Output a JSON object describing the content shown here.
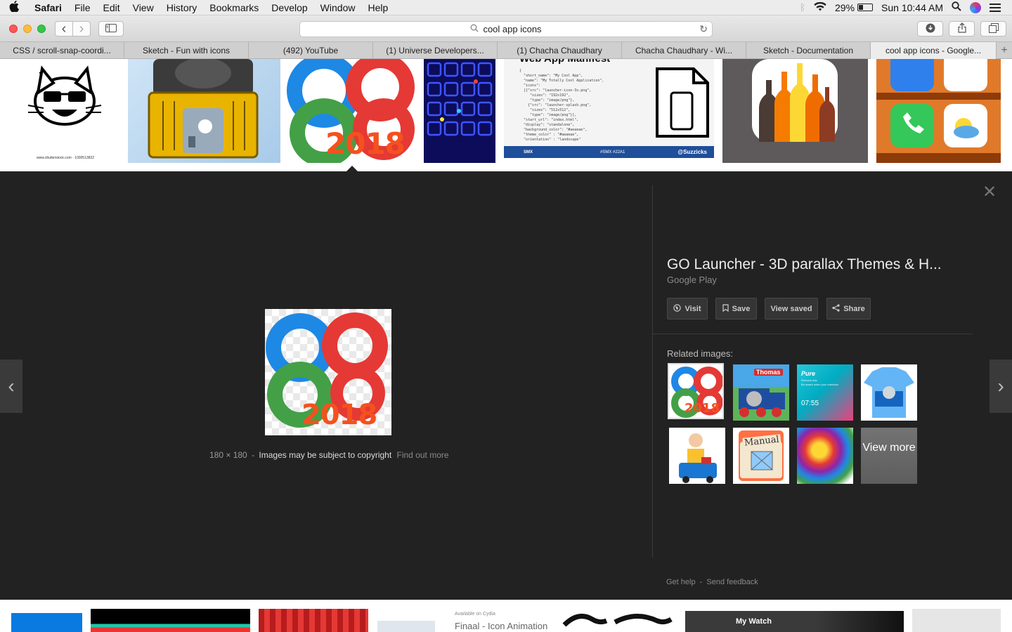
{
  "menubar": {
    "apple": "",
    "items": [
      "Safari",
      "File",
      "Edit",
      "View",
      "History",
      "Bookmarks",
      "Develop",
      "Window",
      "Help"
    ],
    "battery": "29%",
    "clock": "Sun 10:44 AM"
  },
  "toolbar": {
    "address": "cool app icons",
    "reload_glyph": "↻",
    "back_glyph": "‹",
    "forward_glyph": "›"
  },
  "tabs": [
    {
      "label": "CSS / scroll-snap-coordi..."
    },
    {
      "label": "Sketch - Fun with icons"
    },
    {
      "label": "(492) YouTube"
    },
    {
      "label": "(1) Universe Developers..."
    },
    {
      "label": "(1) Chacha Chaudhary"
    },
    {
      "label": "Chacha Chaudhary - Wi..."
    },
    {
      "label": "Sketch - Documentation"
    },
    {
      "label": "cool app icons - Google..."
    }
  ],
  "tab_add": "+",
  "thumbs": {
    "cat_caption": "www.shutterstock.com · 1000513832",
    "manifest_title": "Web App Manifest",
    "manifest_code": "{\n  \"short_name\": \"My Cool App\",\n  \"name\": \"My Totally Cool Application\",\n  \"icons\":\n  [{\"src\": \"launcher-icon-3x.png\",\n     \"sizes\": \"192x192\",\n     \"type\": \"image/png\"},\n    {\"src\": \"launcher-splash.png\",\n     \"sizes\": \"512x512\",\n     \"type\": \"image/png\"}],\n  \"start_url\": \"index.html\",\n  \"display\": \"standalone\",\n  \"background_color\": \"#aeaeae\",\n  \"theme_color\" : \"#aeaeae\",\n  \"orientation\" : \"landscape\"",
    "manifest_footer_left": "SMX",
    "manifest_footer_mid": "#SMX #22A1",
    "manifest_footer_right": "@Suzzicks",
    "go_year": "2018"
  },
  "viewer": {
    "image_year": "2018",
    "dimensions": "180 × 180",
    "separator": "-",
    "copyright_note": "Images may be subject to copyright",
    "find_out_more": "Find out more",
    "title": "GO Launcher - 3D parallax Themes & H...",
    "source": "Google Play",
    "buttons": {
      "visit": "Visit",
      "save": "Save",
      "view_saved": "View saved",
      "share": "Share"
    },
    "related_heading": "Related images:",
    "related_thumbs": {
      "year": "2018",
      "thomas": "Thomas",
      "pure": "Pure",
      "pure_sub": "Remove Ads\nBe aware when your interface",
      "pure_time": "07:55",
      "manual": "Manual"
    },
    "view_more": "View more",
    "get_help": "Get help",
    "send_feedback": "Send feedback",
    "close_glyph": "✕",
    "prev_glyph": "‹",
    "next_glyph": "›"
  },
  "bottom": {
    "cydia_available": "Available on Cydia",
    "cydia_title": "Finaal - Icon Animation",
    "my_watch": "My Watch"
  },
  "colors": {
    "panel_bg": "#222222",
    "accent_red": "#e5332a",
    "accent_blue": "#1e88e5",
    "accent_green": "#43a047"
  }
}
